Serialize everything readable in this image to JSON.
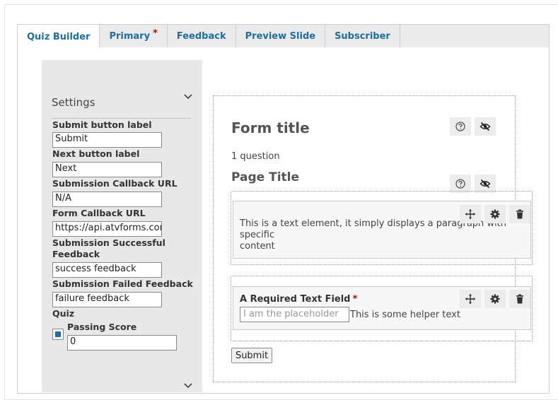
{
  "tabs": [
    {
      "label": "Quiz Builder",
      "active": true
    },
    {
      "label": "Primary",
      "required_marker": "*"
    },
    {
      "label": "Feedback"
    },
    {
      "label": "Preview Slide"
    },
    {
      "label": "Subscriber"
    }
  ],
  "sidebar": {
    "title": "Settings",
    "fields": {
      "submit_label": {
        "label": "Submit button label",
        "value": "Submit"
      },
      "next_label": {
        "label": "Next button label",
        "value": "Next"
      },
      "callback_url": {
        "label": "Submission Callback URL",
        "value": "N/A"
      },
      "form_callback_url": {
        "label": "Form Callback URL",
        "value": "https://api.atvforms.com"
      },
      "success_feedback": {
        "label_line1": "Submission Successful",
        "label_line2": "Feedback",
        "value": "success feedback"
      },
      "failed_feedback": {
        "label": "Submission Failed Feedback",
        "value": "failure feedback"
      },
      "quiz": {
        "label": "Quiz"
      },
      "passing_score": {
        "label": "Passing Score",
        "value": "0",
        "checked": true
      }
    }
  },
  "form": {
    "title": "Form title",
    "question_count": "1 question",
    "page_title": "Page Title",
    "text_element": {
      "line1": "This is a text element, it simply displays a paragraph with specific",
      "line2": "content"
    },
    "required_field": {
      "label": "A Required Text Field",
      "required_marker": "*",
      "placeholder": "I am the placeholder",
      "helper_text": "This is some helper text"
    },
    "submit_button": "Submit"
  },
  "colors": {
    "accent": "#1a6fa8",
    "required": "#cc0000",
    "sidebar_bg": "#e8e8e8"
  },
  "icons": [
    "chevron-down-icon",
    "help-icon",
    "eye-off-icon",
    "move-icon",
    "gear-icon",
    "trash-icon"
  ]
}
